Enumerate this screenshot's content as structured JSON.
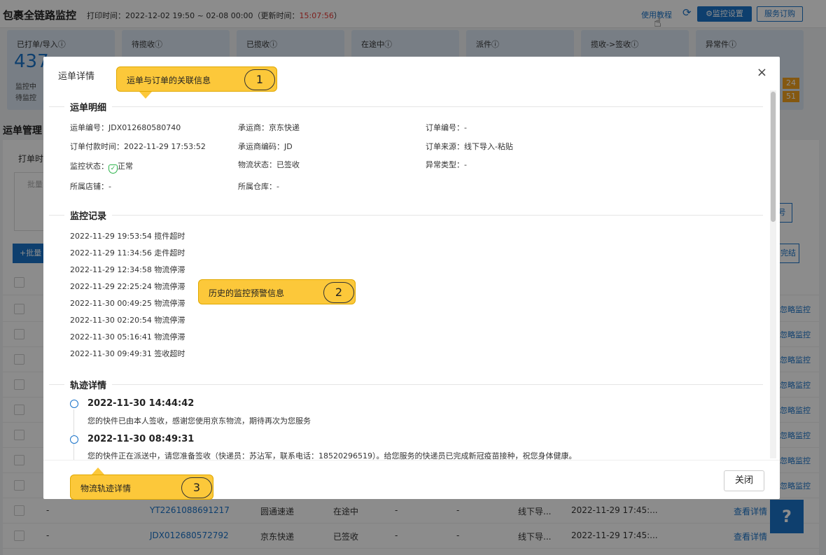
{
  "header": {
    "title": "包裹全链路监控",
    "print_time_label": "打印时间：2022-12-02 19:50 ~ 02-08 00:00",
    "update_prefix": "（更新时间：",
    "update_time": "15:07:56",
    "update_suffix": "）",
    "tutorial": "使用教程",
    "refresh_icon": "⟳",
    "monitor_setting": "⚙监控设置",
    "service_order": "服务订购"
  },
  "cards": [
    {
      "label": "已打单/导入ⓘ",
      "value": "437",
      "line1": "监控中",
      "line2": "待监控"
    },
    {
      "label": "待揽收ⓘ"
    },
    {
      "label": "已揽收ⓘ"
    },
    {
      "label": "在途中ⓘ"
    },
    {
      "label": "派件ⓘ"
    },
    {
      "label": "揽收->签收ⓘ"
    },
    {
      "label": "异常件ⓘ",
      "badge1": "24",
      "badge2": "51"
    }
  ],
  "section_title": "运单管理",
  "filter": {
    "print_time": "打单时",
    "batch": "批量",
    "right_btn": "号"
  },
  "table": {
    "add_button": "+批量",
    "done_button": "完结",
    "ignore": "忽略监控",
    "rows": [
      {
        "dash1": "-",
        "waybill": "YT2261088691217",
        "carrier": "圆通速递",
        "status": "在途中",
        "dash2": "-",
        "dash3": "-",
        "source": "线下导...",
        "time": "2022-11-29 17:45:...",
        "detail": "查看详情"
      },
      {
        "dash1": "-",
        "waybill": "JDX012680572792",
        "carrier": "京东快递",
        "status": "已签收",
        "dash2": "-",
        "dash3": "-",
        "source": "线下导...",
        "time": "2022-11-29 17:45:...",
        "detail": "查看详情"
      }
    ]
  },
  "help_icon": "?",
  "modal": {
    "title": "运单详情",
    "close_icon": "×",
    "detail_section": "运单明细",
    "fields": {
      "waybill_no": "运单编号：JDX012680580740",
      "carrier": "承运商：京东快递",
      "order_no": "订单编号：-",
      "pay_time": "订单付款时间：2022-11-29 17:53:52",
      "carrier_code": "承运商编码：JD",
      "order_source": "订单来源：线下导入-粘贴",
      "monitor_status_label": "监控状态：",
      "monitor_status_value": "正常",
      "logistics_status": "物流状态：已签收",
      "abnormal_type": "异常类型：-",
      "shop": "所属店铺：-",
      "warehouse": "所属仓库：-"
    },
    "records_section": "监控记录",
    "records": [
      "2022-11-29 19:53:54 揽件超时",
      "2022-11-29 11:34:56 走件超时",
      "2022-11-29 12:34:58 物流停滞",
      "2022-11-29 22:25:24 物流停滞",
      "2022-11-30 00:49:25 物流停滞",
      "2022-11-30 02:20:54 物流停滞",
      "2022-11-30 05:16:41 物流停滞",
      "2022-11-30 09:49:31 签收超时"
    ],
    "track_section": "轨迹详情",
    "tracks": [
      {
        "time": "2022-11-30 14:44:42",
        "desc": "您的快件已由本人签收，感谢您使用京东物流，期待再次为您服务"
      },
      {
        "time": "2022-11-30 08:49:31",
        "desc": "您的快件正在派送中，请您准备签收（快递员：苏沾军，联系电话：18520296519）。给您服务的快递员已完成新冠疫苗接种，祝您身体健康。"
      }
    ],
    "close_button": "关闭"
  },
  "callouts": [
    {
      "text": "运单与订单的关联信息",
      "num": "1"
    },
    {
      "text": "历史的监控预警信息",
      "num": "2"
    },
    {
      "text": "物流轨迹详情",
      "num": "3"
    }
  ]
}
